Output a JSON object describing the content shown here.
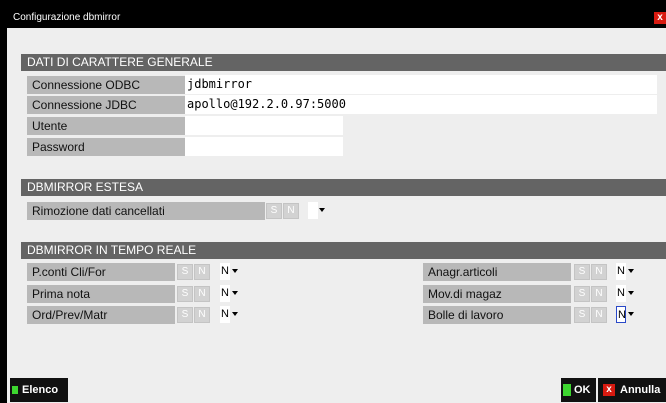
{
  "window": {
    "title": "Configurazione dbmirror",
    "close_label": "x"
  },
  "general": {
    "header": "DATI DI CARATTERE GENERALE",
    "odbc_label": "Connessione ODBC",
    "odbc_value": "jdbmirror",
    "jdbc_label": "Connessione JDBC",
    "jdbc_value": "apollo@192.2.0.97:5000",
    "user_label": "Utente",
    "user_value": "",
    "password_label": "Password",
    "password_value": ""
  },
  "extended": {
    "header": "DBMIRROR ESTESA",
    "rimozione_label": "Rimozione dati cancellati",
    "rimozione_value": ""
  },
  "realtime": {
    "header": "DBMIRROR IN TEMPO REALE",
    "items": [
      {
        "label": "P.conti Cli/For",
        "value": "N"
      },
      {
        "label": "Prima nota",
        "value": "N"
      },
      {
        "label": "Ord/Prev/Matr",
        "value": "N"
      },
      {
        "label": "Anagr.articoli",
        "value": "N"
      },
      {
        "label": "Mov.di magaz",
        "value": "N"
      },
      {
        "label": "Bolle di lavoro",
        "value": "N"
      }
    ]
  },
  "yes_no": {
    "s": "S",
    "n": "N"
  },
  "footer": {
    "elenco": "Elenco",
    "ok": "OK",
    "annulla": "Annulla"
  },
  "colors": {
    "accent_green": "#3dd62f",
    "cancel_red": "#d81a10",
    "header_gray": "#646464"
  }
}
